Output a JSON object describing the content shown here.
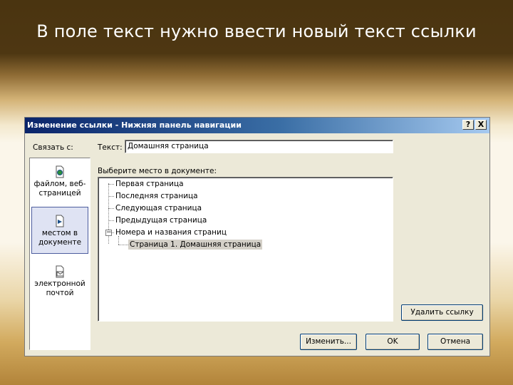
{
  "slide": {
    "title": "В поле текст нужно ввести новый текст ссылки"
  },
  "dialog": {
    "title": "Изменение ссылки - Нижняя панель навигации",
    "help_label": "?",
    "close_label": "X",
    "link_to_label": "Связать с:",
    "text_label": "Текст:",
    "text_value": "Домашняя страница",
    "place_label": "Выберите место в документе:",
    "sidebar": [
      {
        "label": "файлом, веб-страницей",
        "icon": "web-page-icon",
        "selected": false
      },
      {
        "label": "местом в документе",
        "icon": "document-place-icon",
        "selected": true
      },
      {
        "label": "электронной почтой",
        "icon": "email-icon",
        "selected": false
      }
    ],
    "tree": {
      "items": [
        "Первая страница",
        "Последняя страница",
        "Следующая страница",
        "Предыдущая страница"
      ],
      "group": {
        "label": "Номера и названия страниц",
        "expander": "−",
        "children": [
          "Страница 1. Домашняя страница"
        ]
      }
    },
    "buttons": {
      "remove_link": "Удалить ссылку",
      "change": "Изменить...",
      "ok": "OK",
      "cancel": "Отмена"
    }
  }
}
